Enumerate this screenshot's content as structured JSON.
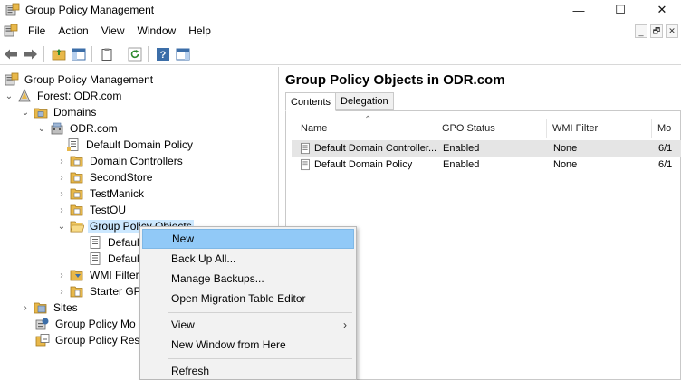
{
  "window": {
    "title": "Group Policy Management",
    "controls": {
      "minimize": "—",
      "maximize": "☐",
      "close": "✕"
    }
  },
  "menubar": {
    "items": [
      "File",
      "Action",
      "View",
      "Window",
      "Help"
    ],
    "mdi_controls": {
      "minimize": "_",
      "restore": "🗗",
      "close": "✕"
    }
  },
  "tree": {
    "items": [
      {
        "label": "Group Policy Management",
        "expander": "",
        "icon": "gpm-console-icon"
      },
      {
        "label": "Forest: ODR.com",
        "expander": "⌄",
        "icon": "forest-icon"
      },
      {
        "label": "Domains",
        "expander": "⌄",
        "icon": "domains-folder-icon"
      },
      {
        "label": "ODR.com",
        "expander": "⌄",
        "icon": "domain-icon"
      },
      {
        "label": "Default Domain Policy",
        "expander": "",
        "icon": "gpo-link-icon"
      },
      {
        "label": "Domain Controllers",
        "expander": "›",
        "icon": "ou-folder-icon"
      },
      {
        "label": "SecondStore",
        "expander": "›",
        "icon": "ou-folder-icon"
      },
      {
        "label": "TestManick",
        "expander": "›",
        "icon": "ou-folder-icon"
      },
      {
        "label": "TestOU",
        "expander": "›",
        "icon": "ou-folder-icon"
      },
      {
        "label": "Group Policy Objects",
        "expander": "⌄",
        "icon": "gpo-folder-icon"
      },
      {
        "label": "Defaul",
        "expander": "",
        "icon": "gpo-icon"
      },
      {
        "label": "Defaul",
        "expander": "",
        "icon": "gpo-icon"
      },
      {
        "label": "WMI Filter",
        "expander": "›",
        "icon": "wmi-folder-icon"
      },
      {
        "label": "Starter GP",
        "expander": "›",
        "icon": "starter-folder-icon"
      },
      {
        "label": "Sites",
        "expander": "›",
        "icon": "sites-icon"
      },
      {
        "label": "Group Policy Mo",
        "expander": "",
        "icon": "modeling-icon"
      },
      {
        "label": "Group Policy Res",
        "expander": "",
        "icon": "results-icon"
      }
    ]
  },
  "right_pane": {
    "title": "Group Policy Objects in ODR.com",
    "tabs": [
      "Contents",
      "Delegation"
    ],
    "columns": [
      "Name",
      "GPO Status",
      "WMI Filter",
      "Mo"
    ],
    "rows": [
      {
        "name": "Default Domain Controller...",
        "status": "Enabled",
        "wmi": "None",
        "mod": "6/1"
      },
      {
        "name": "Default Domain Policy",
        "status": "Enabled",
        "wmi": "None",
        "mod": "6/1"
      }
    ]
  },
  "context_menu": {
    "items": [
      {
        "label": "New"
      },
      {
        "label": "Back Up All..."
      },
      {
        "label": "Manage Backups..."
      },
      {
        "label": "Open Migration Table Editor"
      },
      {
        "label": "View"
      },
      {
        "label": "New Window from Here"
      },
      {
        "label": "Refresh"
      }
    ],
    "submenu_arrow": "›"
  },
  "colors": {
    "selection": "#cce8ff",
    "menu_hot": "#91c9f7",
    "folder": "#e8b84a"
  }
}
